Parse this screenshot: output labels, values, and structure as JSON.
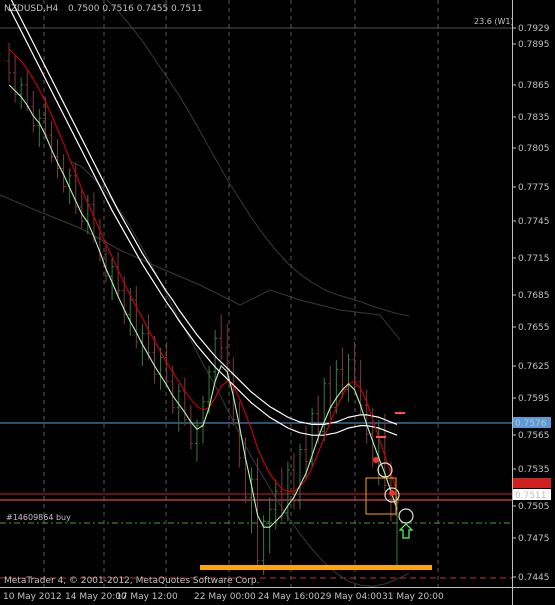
{
  "header": {
    "symbol": "NZDUSD,H4",
    "ohlc": "0.7500 0.7516 0.7455 0.7511",
    "indicator_note": "23.6 (W1)"
  },
  "footer": {
    "copyright": "MetaTrader 4, © 2001-2012, MetaQuotes Software Corp."
  },
  "order_label": "#14609864 buy",
  "price_markers": {
    "blue_line": "0.7576",
    "current": "0.7511"
  },
  "colors": {
    "background": "#000000",
    "grid": "#5a5a5a",
    "candle_up": "#3b7a3b",
    "candle_down": "#7a3b3b",
    "ma_white": "#ffffff",
    "ma_red": "#d10000",
    "ma_green": "#b7f3b7",
    "envelope": "#3a3a3a",
    "blue_line": "#5a9bd8",
    "red_line": "#d12020",
    "order_line": "#3f9f3f",
    "orange": "#ffa500",
    "axis_text": "#c0c0c0"
  },
  "chart_data": {
    "type": "candlestick",
    "symbol": "NZDUSD",
    "timeframe": "H4",
    "y_ticks": [
      "0.7929",
      "0.7895",
      "0.7865",
      "0.7835",
      "0.7805",
      "0.7775",
      "0.7745",
      "0.7715",
      "0.7685",
      "0.7655",
      "0.7625",
      "0.7595",
      "0.7565",
      "0.7535",
      "0.7505",
      "0.7475",
      "0.7445"
    ],
    "x_ticks": [
      "10 May 2012",
      "14 May 20:00",
      "17 May 12:00",
      "22 May 00:00",
      "24 May 16:00",
      "29 May 04:00",
      "31 May 20:00"
    ],
    "ylim": [
      0.744,
      0.7931
    ],
    "horizontal_levels": [
      {
        "name": "blue",
        "value": 0.7576
      },
      {
        "name": "red",
        "value": 0.7515
      },
      {
        "name": "order",
        "value": 0.7488
      },
      {
        "name": "bottom-dashed",
        "value": 0.7444
      }
    ],
    "candles": [
      [
        0.788,
        0.7895,
        0.7862,
        0.787
      ],
      [
        0.787,
        0.7885,
        0.7845,
        0.7852
      ],
      [
        0.7852,
        0.7866,
        0.784,
        0.786
      ],
      [
        0.786,
        0.7872,
        0.7838,
        0.7842
      ],
      [
        0.7842,
        0.7855,
        0.782,
        0.7826
      ],
      [
        0.7826,
        0.784,
        0.7808,
        0.7832
      ],
      [
        0.7832,
        0.785,
        0.7815,
        0.7818
      ],
      [
        0.7818,
        0.783,
        0.7795,
        0.78
      ],
      [
        0.78,
        0.7815,
        0.7782,
        0.779
      ],
      [
        0.779,
        0.7802,
        0.777,
        0.7775
      ],
      [
        0.7775,
        0.779,
        0.776,
        0.7784
      ],
      [
        0.7784,
        0.7795,
        0.7752,
        0.7758
      ],
      [
        0.7758,
        0.7772,
        0.774,
        0.7746
      ],
      [
        0.7746,
        0.7768,
        0.7735,
        0.776
      ],
      [
        0.776,
        0.777,
        0.7728,
        0.7732
      ],
      [
        0.7732,
        0.7748,
        0.7712,
        0.7718
      ],
      [
        0.7718,
        0.773,
        0.7695,
        0.77
      ],
      [
        0.77,
        0.7715,
        0.768,
        0.7708
      ],
      [
        0.7708,
        0.772,
        0.7682,
        0.7688
      ],
      [
        0.7688,
        0.77,
        0.766,
        0.7668
      ],
      [
        0.7668,
        0.769,
        0.765,
        0.768
      ],
      [
        0.768,
        0.7692,
        0.764,
        0.7645
      ],
      [
        0.7645,
        0.766,
        0.7625,
        0.7652
      ],
      [
        0.7652,
        0.7668,
        0.763,
        0.7636
      ],
      [
        0.7636,
        0.765,
        0.761,
        0.7618
      ],
      [
        0.7618,
        0.764,
        0.7605,
        0.7632
      ],
      [
        0.7632,
        0.7645,
        0.7608,
        0.7612
      ],
      [
        0.7612,
        0.7625,
        0.7585,
        0.759
      ],
      [
        0.759,
        0.761,
        0.757,
        0.7604
      ],
      [
        0.7604,
        0.7615,
        0.7575,
        0.758
      ],
      [
        0.758,
        0.7592,
        0.7555,
        0.756
      ],
      [
        0.756,
        0.758,
        0.7545,
        0.7575
      ],
      [
        0.7575,
        0.76,
        0.756,
        0.7595
      ],
      [
        0.7595,
        0.7625,
        0.7585,
        0.762
      ],
      [
        0.762,
        0.7655,
        0.7612,
        0.7648
      ],
      [
        0.7648,
        0.7668,
        0.763,
        0.764
      ],
      [
        0.764,
        0.766,
        0.7612,
        0.7618
      ],
      [
        0.7618,
        0.7632,
        0.7575,
        0.758
      ],
      [
        0.758,
        0.7595,
        0.754,
        0.7548
      ],
      [
        0.7548,
        0.7565,
        0.751,
        0.7515
      ],
      [
        0.7515,
        0.754,
        0.7485,
        0.753
      ],
      [
        0.753,
        0.7548,
        0.7455,
        0.7462
      ],
      [
        0.7462,
        0.75,
        0.745,
        0.7495
      ],
      [
        0.7495,
        0.7515,
        0.7468,
        0.7505
      ],
      [
        0.7505,
        0.753,
        0.7488,
        0.752
      ],
      [
        0.752,
        0.754,
        0.7495,
        0.7502
      ],
      [
        0.7502,
        0.7545,
        0.7495,
        0.7538
      ],
      [
        0.7538,
        0.7552,
        0.7505,
        0.7512
      ],
      [
        0.7512,
        0.756,
        0.7505,
        0.7555
      ],
      [
        0.7555,
        0.7575,
        0.753,
        0.7545
      ],
      [
        0.7545,
        0.759,
        0.754,
        0.7585
      ],
      [
        0.7585,
        0.76,
        0.756,
        0.757
      ],
      [
        0.757,
        0.7615,
        0.7562,
        0.761
      ],
      [
        0.761,
        0.7625,
        0.758,
        0.759
      ],
      [
        0.759,
        0.763,
        0.7585,
        0.7622
      ],
      [
        0.7622,
        0.764,
        0.7598,
        0.7605
      ],
      [
        0.7605,
        0.7635,
        0.7595,
        0.763
      ],
      [
        0.763,
        0.7645,
        0.7605,
        0.7612
      ],
      [
        0.7612,
        0.763,
        0.7585,
        0.7592
      ],
      [
        0.7592,
        0.7605,
        0.756,
        0.7568
      ],
      [
        0.7568,
        0.759,
        0.754,
        0.7548
      ],
      [
        0.7548,
        0.758,
        0.7525,
        0.7572
      ],
      [
        0.7572,
        0.7585,
        0.752,
        0.7525
      ],
      [
        0.7525,
        0.7545,
        0.7495,
        0.75
      ],
      [
        0.75,
        0.7516,
        0.7455,
        0.7511
      ]
    ],
    "series": [
      {
        "color": "#ffffff",
        "values": [
          0.7935,
          0.7925,
          0.7915,
          0.7905,
          0.7895,
          0.7885,
          0.7875,
          0.7865,
          0.7855,
          0.7845,
          0.7835,
          0.7825,
          0.7815,
          0.7805,
          0.7795,
          0.7785,
          0.7775,
          0.7765,
          0.7755,
          0.7746,
          0.7737,
          0.7728,
          0.7719,
          0.7711,
          0.7703,
          0.7695,
          0.7687,
          0.768,
          0.7672,
          0.7665,
          0.7658,
          0.7651,
          0.7645,
          0.7639,
          0.7633,
          0.7628,
          0.7623,
          0.7618,
          0.7613,
          0.7608,
          0.7603,
          0.7599,
          0.7595,
          0.7591,
          0.7588,
          0.7585,
          0.7582,
          0.758,
          0.7578,
          0.7577,
          0.7576,
          0.7576,
          0.7576,
          0.7577,
          0.7578,
          0.758,
          0.7582,
          0.7583,
          0.7584,
          0.7584,
          0.7583,
          0.7582,
          0.758,
          0.7578,
          0.7576
        ]
      },
      {
        "color": "#ffffff",
        "values": [
          0.7925,
          0.7915,
          0.7905,
          0.7895,
          0.7885,
          0.7875,
          0.7865,
          0.7855,
          0.7845,
          0.7835,
          0.7825,
          0.7815,
          0.7805,
          0.7795,
          0.7785,
          0.7775,
          0.7765,
          0.7755,
          0.7746,
          0.7737,
          0.7728,
          0.7719,
          0.771,
          0.7702,
          0.7694,
          0.7686,
          0.7678,
          0.7671,
          0.7663,
          0.7656,
          0.7649,
          0.7642,
          0.7636,
          0.763,
          0.7624,
          0.7619,
          0.7614,
          0.7609,
          0.7604,
          0.7599,
          0.7594,
          0.759,
          0.7586,
          0.7582,
          0.7579,
          0.7576,
          0.7573,
          0.7571,
          0.7569,
          0.7568,
          0.7567,
          0.7567,
          0.7567,
          0.7568,
          0.7569,
          0.7571,
          0.7573,
          0.7574,
          0.7575,
          0.7575,
          0.7574,
          0.7573,
          0.7571,
          0.7569,
          0.7567
        ]
      },
      {
        "color": "#d10000",
        "values": [
          0.789,
          0.7885,
          0.788,
          0.7873,
          0.7865,
          0.7856,
          0.7846,
          0.7835,
          0.7823,
          0.7811,
          0.7798,
          0.7786,
          0.7773,
          0.7761,
          0.775,
          0.7738,
          0.7727,
          0.7716,
          0.7705,
          0.7694,
          0.7684,
          0.7674,
          0.7665,
          0.7655,
          0.7646,
          0.7637,
          0.7628,
          0.762,
          0.7612,
          0.7604,
          0.7597,
          0.7591,
          0.7588,
          0.759,
          0.7598,
          0.7608,
          0.7612,
          0.7608,
          0.7598,
          0.7585,
          0.7572,
          0.7556,
          0.7545,
          0.7535,
          0.7528,
          0.7522,
          0.752,
          0.752,
          0.7524,
          0.753,
          0.754,
          0.7552,
          0.7565,
          0.7578,
          0.759,
          0.76,
          0.761,
          0.7612,
          0.7606,
          0.7595,
          0.758,
          0.7565,
          0.755,
          0.7535,
          0.752
        ]
      },
      {
        "color": "#b7f3b7",
        "values": [
          0.786,
          0.7855,
          0.785,
          0.7843,
          0.7834,
          0.7828,
          0.7818,
          0.7806,
          0.7795,
          0.7785,
          0.7774,
          0.7763,
          0.7752,
          0.7745,
          0.7733,
          0.772,
          0.7706,
          0.7695,
          0.7683,
          0.7672,
          0.7662,
          0.7653,
          0.7643,
          0.7634,
          0.7625,
          0.7617,
          0.7609,
          0.76,
          0.7593,
          0.7586,
          0.7578,
          0.7572,
          0.7575,
          0.759,
          0.7612,
          0.7625,
          0.762,
          0.76,
          0.7575,
          0.7548,
          0.7525,
          0.75,
          0.749,
          0.749,
          0.7495,
          0.75,
          0.7508,
          0.7515,
          0.7525,
          0.7535,
          0.755,
          0.7565,
          0.7578,
          0.759,
          0.7598,
          0.7605,
          0.761,
          0.7605,
          0.7592,
          0.7576,
          0.7562,
          0.7548,
          0.7535,
          0.752,
          0.7505
        ]
      }
    ],
    "envelope": {
      "upper": [
        0.7935,
        0.793,
        0.7922,
        0.7915,
        0.7905,
        0.7893,
        0.788,
        0.7865,
        0.785,
        0.7835,
        0.7818,
        0.78,
        0.7782,
        0.7764,
        0.7748,
        0.7732,
        0.7718,
        0.7705,
        0.7694,
        0.7685,
        0.7678,
        0.7672,
        0.7668,
        0.7665,
        0.7662,
        0.7658,
        0.7655,
        0.7652,
        0.765
      ],
      "lower": [
        0.783,
        0.7825,
        0.7815,
        0.7804,
        0.779,
        0.7775,
        0.7757,
        0.7738,
        0.7718,
        0.7698,
        0.768,
        0.766,
        0.7642,
        0.7622,
        0.7602,
        0.7582,
        0.7565,
        0.7548,
        0.7532,
        0.7518,
        0.7505,
        0.7494,
        0.7485,
        0.7478,
        0.7475,
        0.7474,
        0.7476,
        0.748,
        0.7485
      ]
    }
  }
}
